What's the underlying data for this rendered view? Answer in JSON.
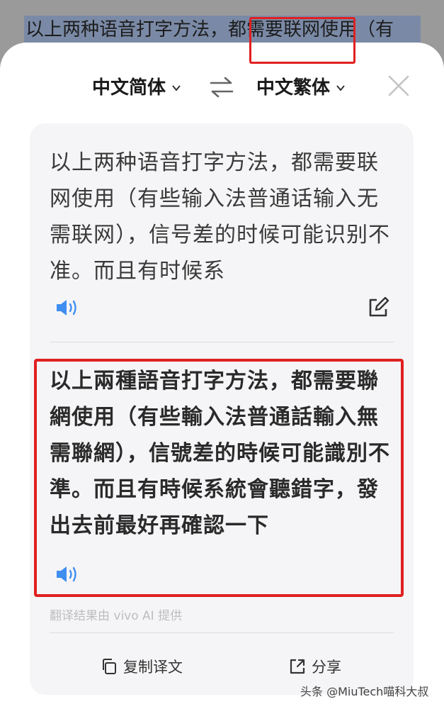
{
  "background": {
    "selected_text": "以上两种语音打字方法，都需要联网使用（有"
  },
  "lang_bar": {
    "source_lang": "中文简体",
    "target_lang": "中文繁体"
  },
  "source": {
    "text": "以上两种语音打字方法，都需要联网使用（有些输入法普通话输入无需联网），信号差的时候可能识别不准。而且有时候系"
  },
  "result": {
    "text": "以上兩種語音打字方法，都需要聯網使用（有些輸入法普通話輸入無需聯網），信號差的時候可能識別不準。而且有時候系統會聽錯字，發出去前最好再確認一下",
    "credit": "翻译结果由 vivo AI 提供"
  },
  "actions": {
    "copy_label": "复制译文",
    "share_label": "分享"
  },
  "watermark": "头条 @MiuTech喵科大叔",
  "colors": {
    "accent_blue": "#3f8ef0",
    "highlight_red": "#e02020"
  }
}
